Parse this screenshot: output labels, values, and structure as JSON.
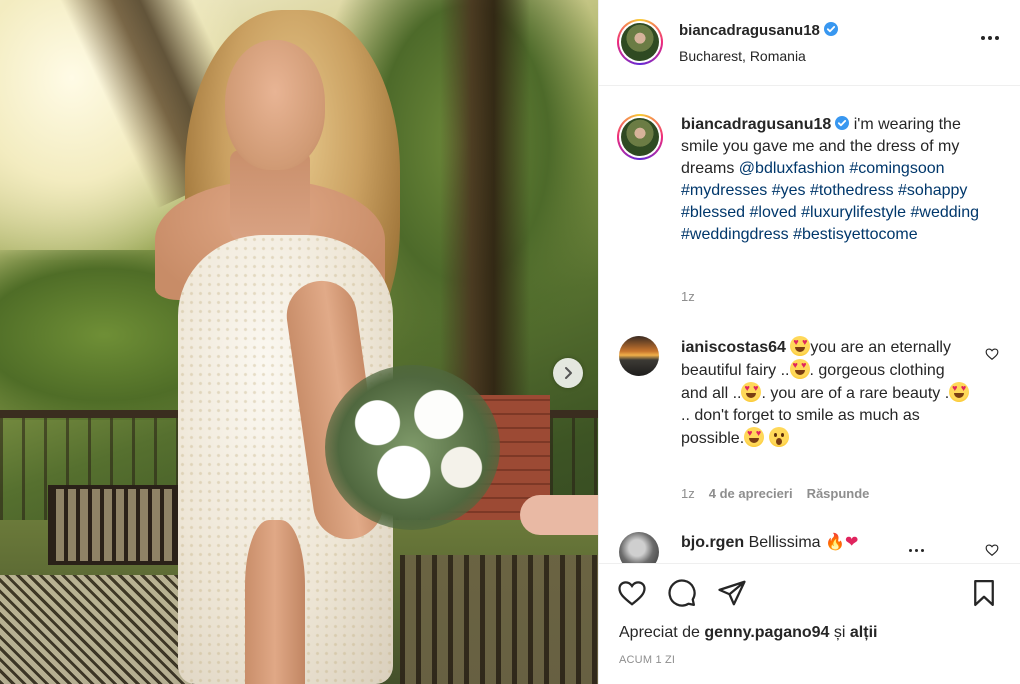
{
  "post": {
    "username": "biancadragusanu18",
    "location": "Bucharest, Romania",
    "caption_prefix": "i'm wearing the smile you gave me and the dress of my dreams ",
    "caption_mention": "@bdluxfashion",
    "caption_tags": [
      "#comingsoon",
      "#mydresses",
      "#yes",
      "#tothedress",
      "#sohappy",
      "#blessed",
      "#loved",
      "#luxurylifestyle",
      "#wedding",
      "#weddingdress",
      "#bestisyettocome"
    ],
    "caption_age": "1z"
  },
  "comments": [
    {
      "username": "ianiscostas64",
      "parts": [
        "you are an eternally beautiful fairy ..",
        ". gorgeous clothing and all ..",
        ". you are of a rare beauty .",
        ".. don't forget to smile as much as possible."
      ],
      "age": "1z",
      "likes": "4 de aprecieri",
      "reply": "Răspunde"
    },
    {
      "username": "bjo.rgen",
      "text": "Bellissima"
    }
  ],
  "footer": {
    "liked_prefix": "Apreciat de ",
    "liked_user": "genny.pagano94",
    "liked_suffix": " și ",
    "liked_others": "alții",
    "timestamp": "ACUM 1 ZI"
  },
  "colors": {
    "link": "#00376b",
    "secondary_text": "#8e8e8e",
    "verified": "#3897f0"
  },
  "icons": {
    "verified": "verified-badge-icon",
    "like": "heart-icon",
    "comment": "comment-icon",
    "share": "paper-plane-icon",
    "save": "bookmark-icon",
    "more": "more-options-icon",
    "next": "chevron-right-icon"
  }
}
